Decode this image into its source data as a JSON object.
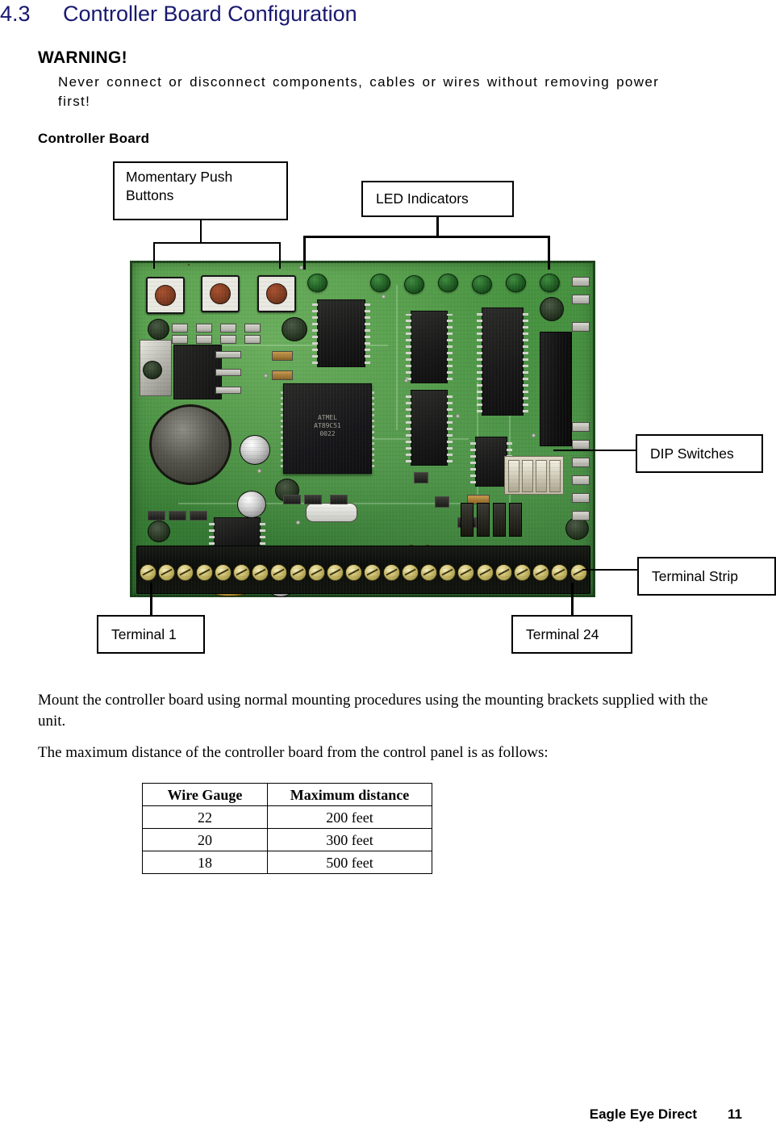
{
  "document": {
    "section_number": "4.3",
    "section_title": "Controller Board Configuration",
    "heading_color": "#191970"
  },
  "warning": {
    "title": "WARNING!",
    "text": "Never connect or disconnect components, cables or wires without removing power first!"
  },
  "subhead": "Controller Board",
  "figure": {
    "callouts": [
      {
        "id": "momentary-push-buttons",
        "line1": "Momentary Push",
        "line2": "Buttons"
      },
      {
        "id": "led-indicators",
        "label": "LED Indicators"
      },
      {
        "id": "dip-switches",
        "label": "DIP Switches"
      },
      {
        "id": "terminal-strip",
        "label": "Terminal Strip"
      },
      {
        "id": "terminal-1",
        "label": "Terminal 1"
      },
      {
        "id": "terminal-24",
        "label": "Terminal 24"
      }
    ],
    "board": {
      "alt": "Photograph of the green controller circuit board",
      "push_button_count": 3,
      "led_count": 7,
      "terminal_count": 24,
      "dip_switch_count": 4,
      "main_ic_label": "ATMEL AT89C51 0022"
    }
  },
  "body": {
    "paragraph1": "Mount the controller board using normal mounting procedures using the mounting brackets supplied with the unit.",
    "paragraph2": "The maximum distance of the controller board from the control panel is as follows:"
  },
  "table": {
    "headers": [
      "Wire Gauge",
      "Maximum distance"
    ],
    "rows": [
      [
        "22",
        "200 feet"
      ],
      [
        "20",
        "300 feet"
      ],
      [
        "18",
        "500 feet"
      ]
    ]
  },
  "footer": {
    "company": "Eagle Eye Direct",
    "page_number": "11"
  }
}
